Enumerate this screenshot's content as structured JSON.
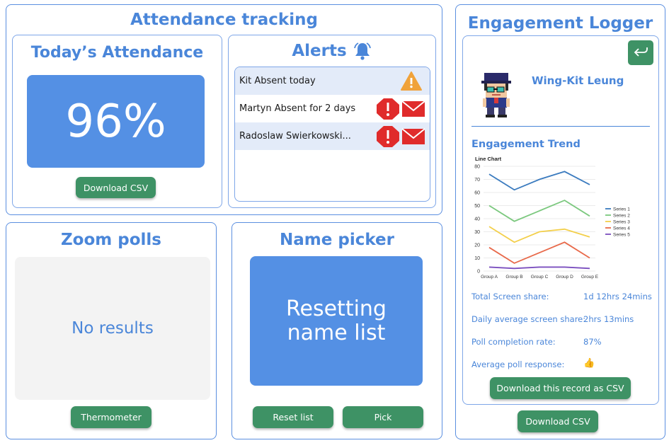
{
  "attendance": {
    "title": "Attendance tracking",
    "today_title": "Today’s Attendance",
    "percent": "96%",
    "download_label": "Download CSV"
  },
  "alerts": {
    "title": "Alerts",
    "items": [
      {
        "text": "Kit Absent today",
        "icon": "warning-triangle-icon"
      },
      {
        "text": "Martyn Absent for 2 days",
        "icon": "error-octagon-icon"
      },
      {
        "text": "Radoslaw Swierkowski...",
        "icon": "error-octagon-icon"
      }
    ]
  },
  "zoom_polls": {
    "title": "Zoom polls",
    "empty_text": "No results",
    "thermometer_label": "Thermometer"
  },
  "name_picker": {
    "title": "Name picker",
    "status_text": "Resetting name list",
    "reset_label": "Reset list",
    "pick_label": "Pick"
  },
  "engagement": {
    "title": "Engagement Logger",
    "student_name": "Wing-Kit Leung",
    "trend_title": "Engagement Trend",
    "stats": [
      {
        "label": "Total Screen share:",
        "value": "1d 12hrs 24mins"
      },
      {
        "label": "Daily average screen share:",
        "value": "2hrs 13mins"
      },
      {
        "label": "Poll completion rate:",
        "value": "87%"
      },
      {
        "label": "Average poll response:",
        "value": "👍"
      }
    ],
    "download_record_label": "Download this record as CSV",
    "download_label": "Download CSV"
  },
  "chart_data": {
    "type": "line",
    "title": "Line Chart",
    "categories": [
      "Group A",
      "Group B",
      "Group C",
      "Group D",
      "Group E"
    ],
    "ylim": [
      0,
      80
    ],
    "yticks": [
      0,
      10,
      20,
      30,
      40,
      50,
      60,
      70,
      80
    ],
    "grid": true,
    "legend": "right",
    "series": [
      {
        "name": "Series 1",
        "color": "#3b7bbf",
        "values": [
          74,
          62,
          70,
          76,
          66
        ]
      },
      {
        "name": "Series 2",
        "color": "#7bc87e",
        "values": [
          50,
          38,
          46,
          54,
          42
        ]
      },
      {
        "name": "Series 3",
        "color": "#f3cf4a",
        "values": [
          34,
          22,
          30,
          32,
          26
        ]
      },
      {
        "name": "Series 4",
        "color": "#e8694a",
        "values": [
          18,
          6,
          14,
          22,
          10
        ]
      },
      {
        "name": "Series 5",
        "color": "#7b4fbf",
        "values": [
          3,
          2,
          3,
          3,
          2
        ]
      }
    ]
  }
}
